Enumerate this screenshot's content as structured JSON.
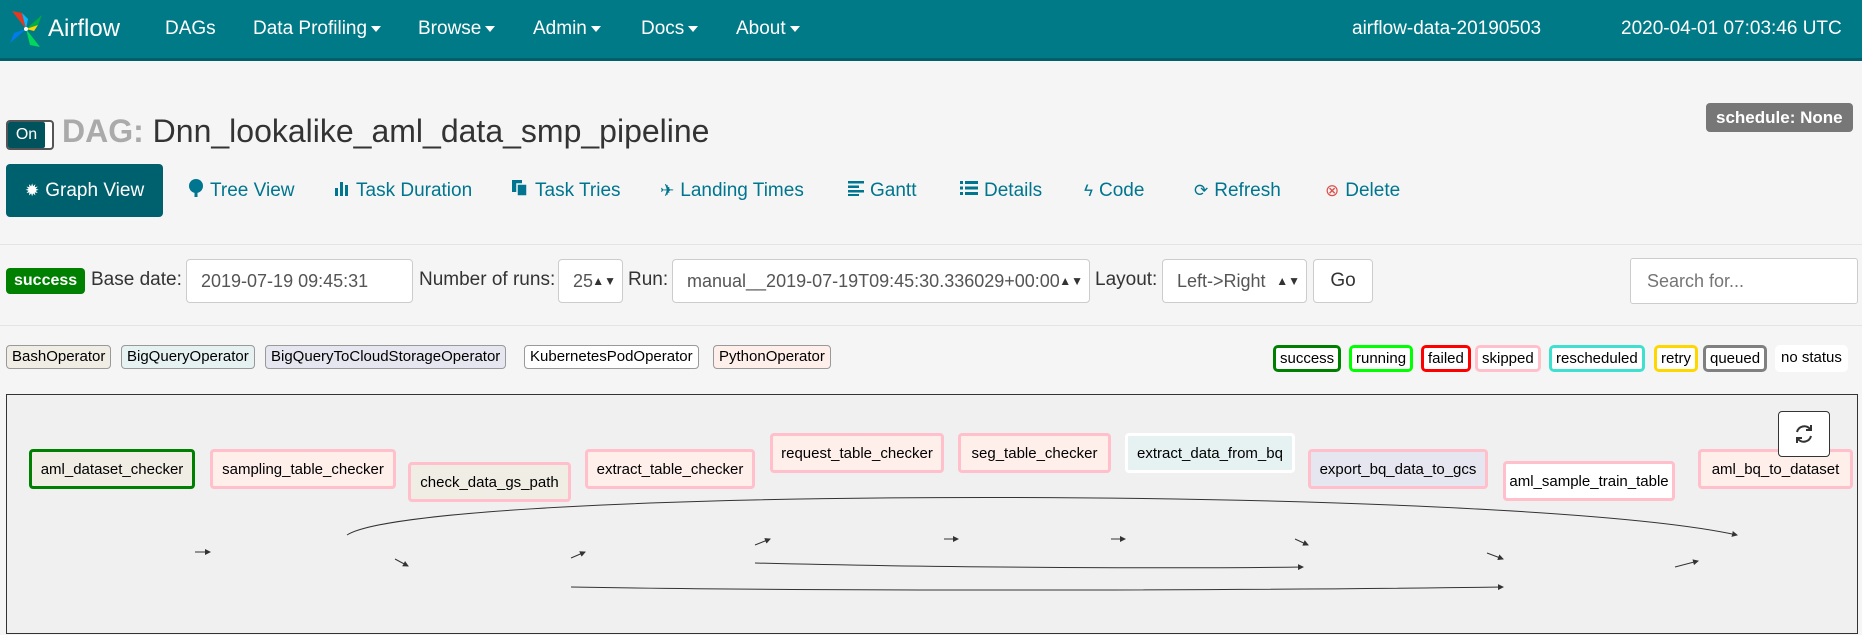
{
  "navbar": {
    "brand": "Airflow",
    "items": [
      "DAGs",
      "Data Profiling",
      "Browse",
      "Admin",
      "Docs",
      "About"
    ],
    "hostname": "airflow-data-20190503",
    "clock": "2020-04-01 07:03:46 UTC"
  },
  "dag": {
    "toggle": "On",
    "prefix": "DAG:",
    "name": "Dnn_lookalike_aml_data_smp_pipeline",
    "schedule": "schedule: None"
  },
  "tabs": [
    {
      "label": "Graph View",
      "icon": "asterisk-icon"
    },
    {
      "label": "Tree View",
      "icon": "tree-icon"
    },
    {
      "label": "Task Duration",
      "icon": "bar-chart-icon"
    },
    {
      "label": "Task Tries",
      "icon": "duplicate-icon"
    },
    {
      "label": "Landing Times",
      "icon": "plane-icon"
    },
    {
      "label": "Gantt",
      "icon": "align-left-icon"
    },
    {
      "label": "Details",
      "icon": "list-icon"
    },
    {
      "label": "Code",
      "icon": "flash-icon"
    },
    {
      "label": "Refresh",
      "icon": "refresh-icon"
    },
    {
      "label": "Delete",
      "icon": "remove-circle-icon"
    }
  ],
  "form": {
    "state_badge": "success",
    "base_date_label": "Base date:",
    "base_date": "2019-07-19 09:45:31",
    "num_runs_label": "Number of runs:",
    "num_runs": "25",
    "run_label": "Run:",
    "run": "manual__2019-07-19T09:45:30.336029+00:00",
    "layout_label": "Layout:",
    "layout": "Left->Right",
    "go": "Go",
    "search_placeholder": "Search for..."
  },
  "operators": [
    {
      "label": "BashOperator",
      "color": "#f0ede4"
    },
    {
      "label": "BigQueryOperator",
      "color": "#e6f1f2"
    },
    {
      "label": "BigQueryToCloudStorageOperator",
      "color": "#e6e6f0"
    },
    {
      "label": "KubernetesPodOperator",
      "color": "#ffffff"
    },
    {
      "label": "PythonOperator",
      "color": "#ffefeb"
    }
  ],
  "states": [
    {
      "label": "success",
      "color": "#008000"
    },
    {
      "label": "running",
      "color": "#00ff00"
    },
    {
      "label": "failed",
      "color": "#ff0000"
    },
    {
      "label": "skipped",
      "color": "#ffc0cb"
    },
    {
      "label": "rescheduled",
      "color": "#40e0d0"
    },
    {
      "label": "retry",
      "color": "#ffd700"
    },
    {
      "label": "queued",
      "color": "#808080"
    },
    {
      "label": "no status",
      "color": "#ffffff"
    }
  ],
  "graph": {
    "nodes": [
      {
        "id": "aml_dataset_checker",
        "fill": "#f0ede4",
        "border": "#008000"
      },
      {
        "id": "sampling_table_checker",
        "fill": "#ffefeb",
        "border": "#ffc0cb"
      },
      {
        "id": "check_data_gs_path",
        "fill": "#f0ede4",
        "border": "#ffc0cb"
      },
      {
        "id": "extract_table_checker",
        "fill": "#ffefeb",
        "border": "#ffc0cb"
      },
      {
        "id": "request_table_checker",
        "fill": "#ffefeb",
        "border": "#ffc0cb"
      },
      {
        "id": "seg_table_checker",
        "fill": "#ffefeb",
        "border": "#ffc0cb"
      },
      {
        "id": "extract_data_from_bq",
        "fill": "#e6f1f2",
        "border": "#ffffff"
      },
      {
        "id": "export_bq_data_to_gcs",
        "fill": "#e6e6f0",
        "border": "#ffc0cb"
      },
      {
        "id": "aml_sample_train_table",
        "fill": "#ffffff",
        "border": "#ffc0cb"
      },
      {
        "id": "aml_bq_to_dataset",
        "fill": "#ffefeb",
        "border": "#ffc0cb"
      }
    ]
  }
}
